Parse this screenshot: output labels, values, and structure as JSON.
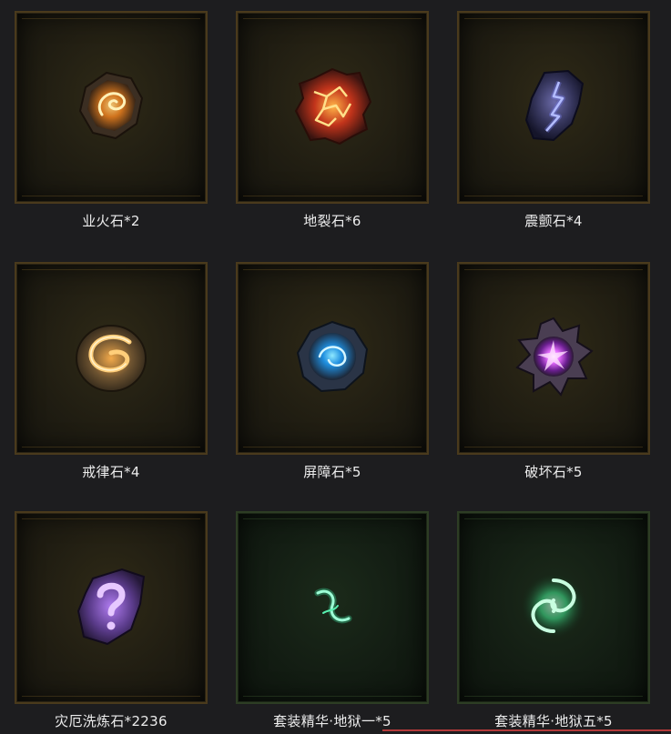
{
  "items": [
    {
      "label": "业火石*2",
      "icon": "hellfire-stone-icon",
      "frame": "gold"
    },
    {
      "label": "地裂石*6",
      "icon": "earthsplit-stone-icon",
      "frame": "gold"
    },
    {
      "label": "震颤石*4",
      "icon": "tremor-stone-icon",
      "frame": "gold"
    },
    {
      "label": "戒律石*4",
      "icon": "discipline-stone-icon",
      "frame": "gold"
    },
    {
      "label": "屏障石*5",
      "icon": "barrier-stone-icon",
      "frame": "gold"
    },
    {
      "label": "破坏石*5",
      "icon": "destruction-stone-icon",
      "frame": "gold"
    },
    {
      "label": "灾厄洗炼石*2236",
      "icon": "calamity-reforge-stone-icon",
      "frame": "gold"
    },
    {
      "label": "套装精华·地狱一*5",
      "icon": "set-essence-hell-1-icon",
      "frame": "green"
    },
    {
      "label": "套装精华·地狱五*5",
      "icon": "set-essence-hell-5-icon",
      "frame": "green"
    }
  ],
  "colors": {
    "background": "#1d1d1f",
    "gold_frame": "#4a3a1c",
    "green_frame": "#2d3d24",
    "label_text": "#ececec",
    "accent_line": "#b33a3a"
  }
}
